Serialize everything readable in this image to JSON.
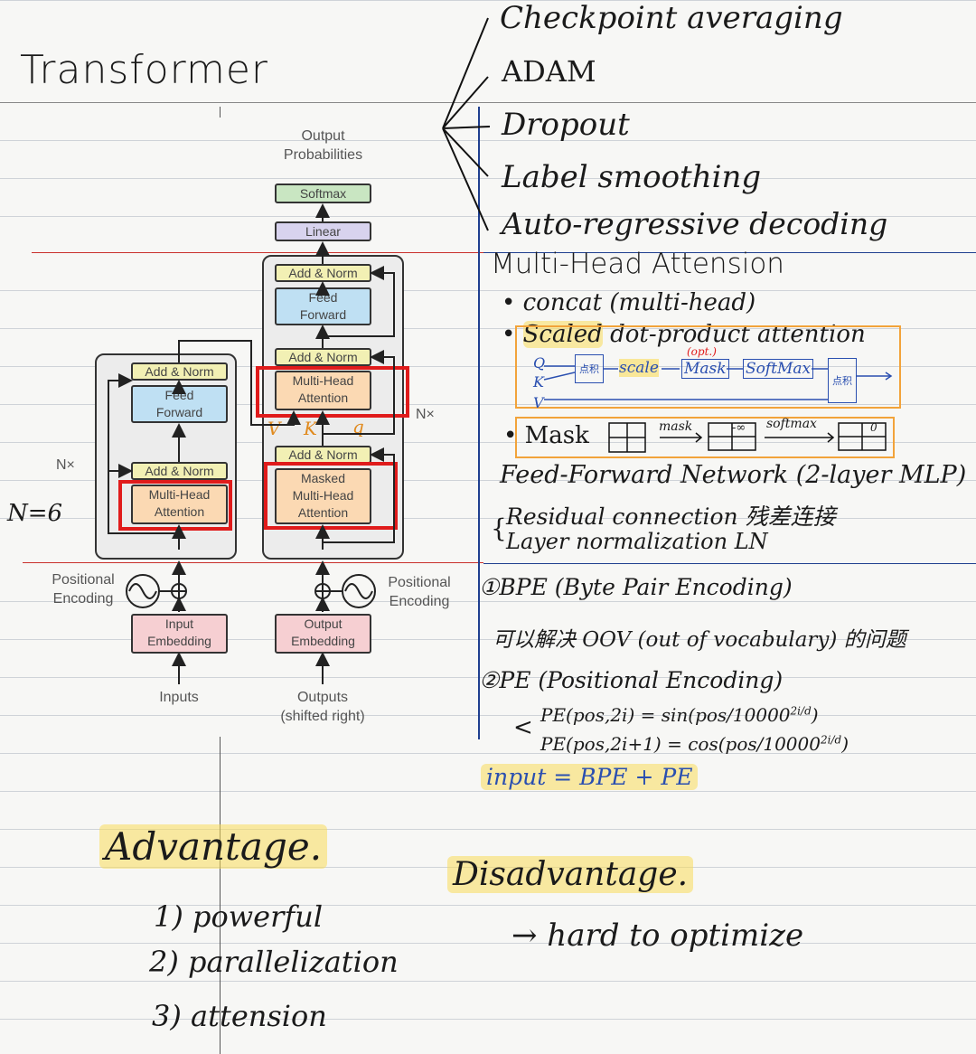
{
  "title": "Transformer",
  "branches": [
    "Checkpoint averaging",
    "ADAM",
    "Dropout",
    "Label smoothing",
    "Auto-regressive decoding"
  ],
  "diagram": {
    "output_probabilities": "Output\nProbabilities",
    "softmax": "Softmax",
    "linear": "Linear",
    "add_norm": "Add & Norm",
    "feed_forward": "Feed\nForward",
    "multi_head_attention": "Multi-Head\nAttention",
    "masked_multi_head_attention": "Masked\nMulti-Head\nAttention",
    "nx": "N×",
    "positional_encoding": "Positional\nEncoding",
    "input_embedding": "Input\nEmbedding",
    "output_embedding": "Output\nEmbedding",
    "inputs": "Inputs",
    "outputs": "Outputs\n(shifted right)",
    "vkq": [
      "V",
      "K",
      "q"
    ],
    "n_equals": "N=6"
  },
  "mha": {
    "heading": "Multi-Head Attension",
    "concat": "• concat (multi-head)",
    "scaled_prefix": "Scaled",
    "scaled_rest": " dot-product attention",
    "flow": {
      "q": "Q",
      "k": "K",
      "v": "V",
      "matmul1": "点积",
      "scale": "scale",
      "opt": "(opt.)",
      "mask": "Mask",
      "softmax": "SoftMax",
      "matmul2": "点积"
    },
    "mask_row": {
      "label": "• Mask",
      "mask_arrow": "mask",
      "neg_inf": "-∞",
      "softmax_arrow": "softmax",
      "zero": "0"
    },
    "ffn": "Feed-Forward Network (2-layer MLP)",
    "residual": "Residual connection 残差连接",
    "layernorm": "Layer normalization    LN"
  },
  "bpe": {
    "title": "①BPE (Byte Pair Encoding)",
    "desc": "可以解决 OOV (out of vocabulary) 的问题",
    "pe_title": "②PE (Positional Encoding)",
    "pe1": "PE(pos,2i) = sin(pos/10000",
    "pe1_sup": "2i/d",
    "pe2": "PE(pos,2i+1) = cos(pos/10000",
    "pe2_sup": "2i/d",
    "input": "input = BPE + PE"
  },
  "advantage": {
    "title": "Advantage.",
    "items": [
      "1) powerful",
      "2) parallelization",
      "3) attension"
    ]
  },
  "disadvantage": {
    "title": "Disadvantage.",
    "item": "→ hard to optimize"
  },
  "colors": {
    "red_box": "#e01b1b",
    "orange_box": "#f2a33a",
    "blue_ink": "#2a4fb0",
    "highlight": "#fadc5a",
    "red_line": "#c9302c",
    "rule": "#cfd3d8"
  }
}
